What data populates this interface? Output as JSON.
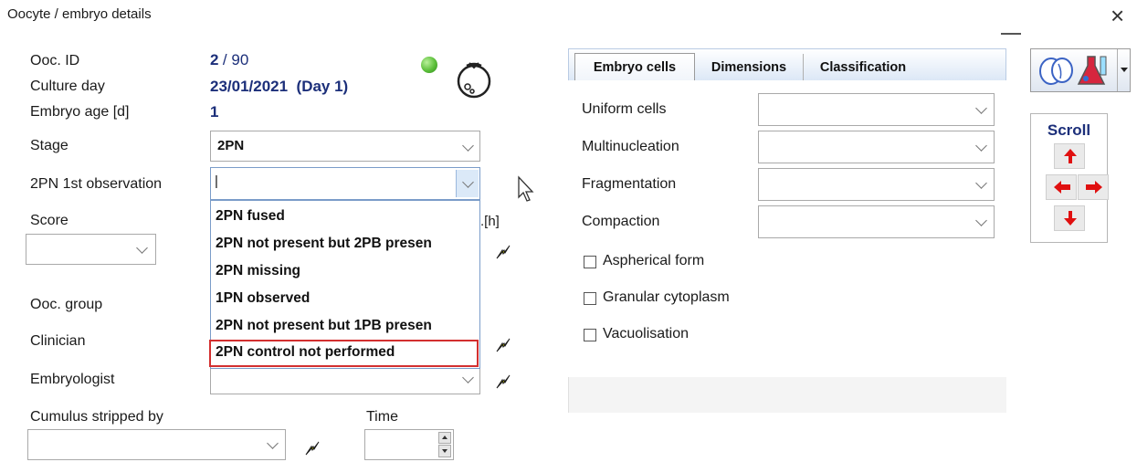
{
  "window": {
    "title": "Oocyte / embryo details",
    "close_glyph": "×",
    "minimize_glyph": "—"
  },
  "left": {
    "ooc_id_label": "Ooc. ID",
    "ooc_id_value": "2",
    "ooc_id_total": "/ 90",
    "culture_day_label": "Culture day",
    "culture_day_value": "23/01/2021  (Day 1)",
    "embryo_age_label": "Embryo age [d]",
    "embryo_age_value": "1",
    "stage_label": "Stage",
    "stage_value": "2PN",
    "obs_label": "2PN 1st observation",
    "obs_value": "|",
    "score_label": "Score",
    "hours_suffix": ".[h]",
    "ooc_group_label": "Ooc. group",
    "clinician_label": "Clinician",
    "embryologist_label": "Embryologist",
    "cumulus_label": "Cumulus stripped by",
    "time_label": "Time"
  },
  "dropdown": {
    "options": [
      "2PN fused",
      "2PN not present but 2PB presen",
      "2PN missing",
      "1PN observed",
      "2PN not present but 1PB presen",
      "2PN control not performed"
    ],
    "highlighted_index": 5
  },
  "tabs": {
    "items": [
      "Embryo cells",
      "Dimensions",
      "Classification"
    ],
    "active": "Embryo cells"
  },
  "embryo_cells": {
    "uniform_cells_label": "Uniform cells",
    "multinucleation_label": "Multinucleation",
    "fragmentation_label": "Fragmentation",
    "compaction_label": "Compaction",
    "aspherical_label": "Aspherical form",
    "granular_label": "Granular cytoplasm",
    "vacuolisation_label": "Vacuolisation"
  },
  "scroll": {
    "title": "Scroll"
  },
  "colors": {
    "highlight_border": "#d32f2f",
    "status_green": "#5cbf3a",
    "tab_gradient_top": "#ffffff",
    "tab_gradient_bottom": "#cfe0f5"
  }
}
